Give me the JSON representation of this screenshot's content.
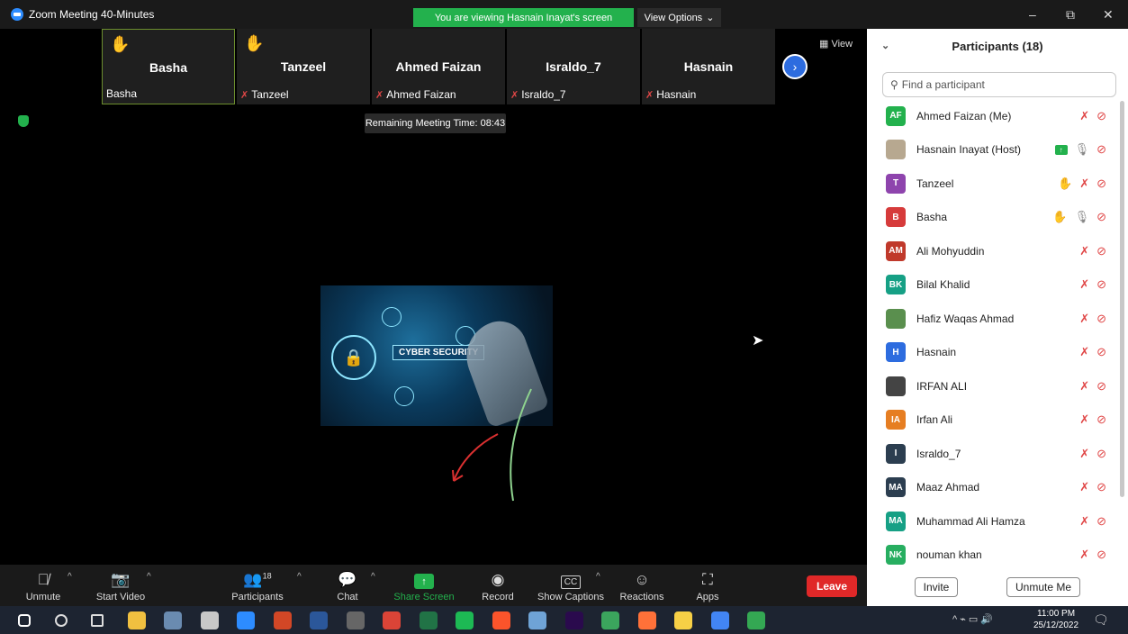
{
  "window": {
    "title": "Zoom Meeting 40-Minutes",
    "banner": "You are viewing Hasnain Inayat's screen",
    "view_options": "View Options",
    "controls": [
      "–",
      "⧉",
      "✕"
    ]
  },
  "thumbnails": [
    {
      "big": "Basha",
      "small": "Basha",
      "hand": true,
      "muted": false
    },
    {
      "big": "Tanzeel",
      "small": "Tanzeel",
      "hand": true,
      "muted": true
    },
    {
      "big": "Ahmed Faizan",
      "small": "Ahmed Faizan",
      "hand": false,
      "muted": true
    },
    {
      "big": "Israldo_7",
      "small": "Israldo_7",
      "hand": false,
      "muted": true
    },
    {
      "big": "Hasnain",
      "small": "Hasnain",
      "hand": false,
      "muted": true
    }
  ],
  "view_label": "View",
  "remaining_time": "Remaining Meeting Time: 08:43",
  "shared_image_label": "CYBER SECURITY",
  "toolbar": {
    "unmute": "Unmute",
    "start_video": "Start Video",
    "participants": "Participants",
    "participants_count": "18",
    "chat": "Chat",
    "share_screen": "Share Screen",
    "record": "Record",
    "captions": "Show Captions",
    "captions_icon": "CC",
    "reactions": "Reactions",
    "apps": "Apps",
    "leave": "Leave"
  },
  "panel": {
    "title": "Participants (18)",
    "search_placeholder": "Find a participant",
    "invite": "Invite",
    "unmute_me": "Unmute Me",
    "participants": [
      {
        "initials": "AF",
        "name": "Ahmed Faizan (Me)",
        "color": "#23b14d",
        "hand": false,
        "mic": "off",
        "share": false
      },
      {
        "initials": "",
        "name": "Hasnain Inayat (Host)",
        "color": "#b7a890",
        "hand": false,
        "mic": "on",
        "share": true
      },
      {
        "initials": "T",
        "name": "Tanzeel",
        "color": "#8e44ad",
        "hand": true,
        "mic": "off",
        "share": false
      },
      {
        "initials": "B",
        "name": "Basha",
        "color": "#d63b3b",
        "hand": true,
        "mic": "on",
        "share": false
      },
      {
        "initials": "AM",
        "name": "Ali Mohyuddin",
        "color": "#c0392b",
        "hand": false,
        "mic": "off",
        "share": false
      },
      {
        "initials": "BK",
        "name": "Bilal Khalid",
        "color": "#16a085",
        "hand": false,
        "mic": "off",
        "share": false
      },
      {
        "initials": "",
        "name": "Hafiz Waqas Ahmad",
        "color": "#5a8f4e",
        "hand": false,
        "mic": "off",
        "share": false
      },
      {
        "initials": "H",
        "name": "Hasnain",
        "color": "#2d6cdf",
        "hand": false,
        "mic": "off",
        "share": false
      },
      {
        "initials": "",
        "name": "IRFAN ALI",
        "color": "#444444",
        "hand": false,
        "mic": "off",
        "share": false
      },
      {
        "initials": "IA",
        "name": "Irfan Ali",
        "color": "#e67e22",
        "hand": false,
        "mic": "off",
        "share": false
      },
      {
        "initials": "I",
        "name": "Israldo_7",
        "color": "#2c3e50",
        "hand": false,
        "mic": "off",
        "share": false
      },
      {
        "initials": "MA",
        "name": "Maaz Ahmad",
        "color": "#2c3e50",
        "hand": false,
        "mic": "off",
        "share": false
      },
      {
        "initials": "MA",
        "name": "Muhammad Ali Hamza",
        "color": "#16a085",
        "hand": false,
        "mic": "off",
        "share": false
      },
      {
        "initials": "NK",
        "name": "nouman khan",
        "color": "#27ae60",
        "hand": false,
        "mic": "off",
        "share": false
      }
    ]
  },
  "taskbar": {
    "time": "11:00 PM",
    "date": "25/12/2022",
    "icons": [
      "windows-icon",
      "search-icon",
      "taskview-icon",
      "file-explorer-icon",
      "photos-icon",
      "paint-icon",
      "zoom-icon",
      "powerpoint-icon",
      "word-icon",
      "calculator-icon",
      "chrome-icon",
      "excel-icon",
      "spotify-icon",
      "brave-icon",
      "weather-icon",
      "premiere-icon",
      "vpn-icon",
      "firefox-icon",
      "sticky-notes-icon",
      "chrome-profile-icon",
      "chrome-profile2-icon"
    ]
  }
}
